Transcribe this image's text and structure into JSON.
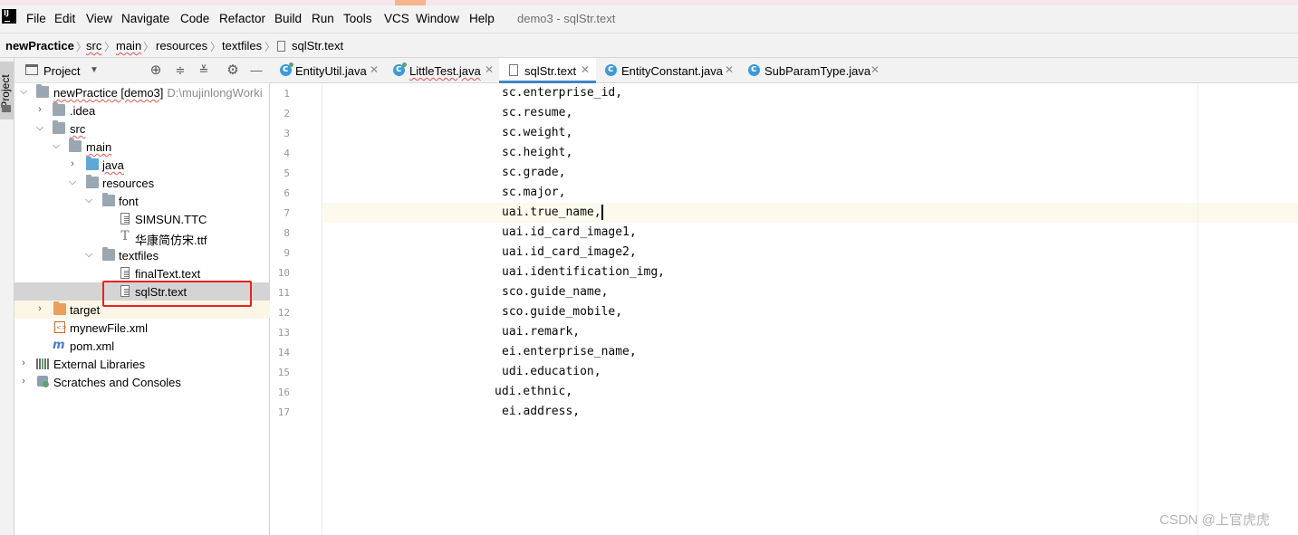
{
  "menubar": {
    "items": [
      {
        "label": "File",
        "mnemonic": "F"
      },
      {
        "label": "Edit",
        "mnemonic": "E"
      },
      {
        "label": "View",
        "mnemonic": "V"
      },
      {
        "label": "Navigate",
        "mnemonic": "N"
      },
      {
        "label": "Code",
        "mnemonic": "C"
      },
      {
        "label": "Refactor",
        "mnemonic": "R"
      },
      {
        "label": "Build",
        "mnemonic": "B"
      },
      {
        "label": "Run",
        "mnemonic": "u"
      },
      {
        "label": "Tools",
        "mnemonic": "T"
      },
      {
        "label": "VCS",
        "mnemonic": "S"
      },
      {
        "label": "Window",
        "mnemonic": "W"
      },
      {
        "label": "Help",
        "mnemonic": "H"
      }
    ],
    "window_title": "demo3 - sqlStr.text"
  },
  "breadcrumb": {
    "items": [
      "newPractice",
      "src",
      "main",
      "resources",
      "textfiles",
      "sqlStr.text"
    ]
  },
  "tool_strip": {
    "project_label": "Project"
  },
  "project_panel": {
    "title": "Project",
    "tree": [
      {
        "label": "newPractice [demo3]",
        "hint": "D:\\mujinlongWorki",
        "icon": "folder-icon",
        "expanded": true
      },
      {
        "label": ".idea",
        "icon": "folder-icon",
        "expanded": false
      },
      {
        "label": "src",
        "icon": "folder-icon",
        "expanded": true
      },
      {
        "label": "main",
        "icon": "folder-icon",
        "expanded": true
      },
      {
        "label": "java",
        "icon": "source-folder-icon",
        "expanded": false
      },
      {
        "label": "resources",
        "icon": "resources-folder-icon",
        "expanded": true
      },
      {
        "label": "font",
        "icon": "folder-icon",
        "expanded": true
      },
      {
        "label": "SIMSUN.TTC",
        "icon": "text-file-icon"
      },
      {
        "label": "华康简仿宋.ttf",
        "icon": "font-file-icon"
      },
      {
        "label": "textfiles",
        "icon": "folder-icon",
        "expanded": true
      },
      {
        "label": "finalText.text",
        "icon": "text-file-icon"
      },
      {
        "label": "sqlStr.text",
        "icon": "text-file-icon",
        "selected": true
      },
      {
        "label": "target",
        "icon": "excluded-folder-icon",
        "expanded": false
      },
      {
        "label": "mynewFile.xml",
        "icon": "xml-file-icon"
      },
      {
        "label": "pom.xml",
        "icon": "maven-icon"
      },
      {
        "label": "External Libraries",
        "icon": "library-icon",
        "expanded": false
      },
      {
        "label": "Scratches and Consoles",
        "icon": "scratch-icon",
        "expanded": false
      }
    ]
  },
  "tabs": [
    {
      "label": "EntityUtil.java",
      "icon": "java-class-icon",
      "active": false
    },
    {
      "label": "LittleTest.java",
      "icon": "java-class-icon",
      "active": false
    },
    {
      "label": "sqlStr.text",
      "icon": "text-file-icon",
      "active": true
    },
    {
      "label": "EntityConstant.java",
      "icon": "java-class-icon",
      "active": false
    },
    {
      "label": "SubParamType.java",
      "icon": "java-class-icon",
      "active": false
    }
  ],
  "editor": {
    "lines": [
      "sc.enterprise_id,",
      "sc.resume,",
      "sc.weight,",
      "sc.height,",
      "sc.grade,",
      "sc.major,",
      "uai.true_name,",
      "uai.id_card_image1,",
      "uai.id_card_image2,",
      "uai.identification_img,",
      "sco.guide_name,",
      "sco.guide_mobile,",
      "uai.remark,",
      "ei.enterprise_name,",
      "udi.education,",
      "udi.ethnic,",
      "ei.address,"
    ],
    "line_numbers": [
      "1",
      "2",
      "3",
      "4",
      "5",
      "6",
      "7",
      "8",
      "9",
      "10",
      "11",
      "12",
      "13",
      "14",
      "15",
      "16",
      "17"
    ],
    "current_line": 7
  },
  "watermark": "CSDN @上官虎虎",
  "colors": {
    "highlight_box": "#e8231b",
    "active_tab_underline": "#4083c9",
    "current_line_bg": "#fcfaed"
  }
}
